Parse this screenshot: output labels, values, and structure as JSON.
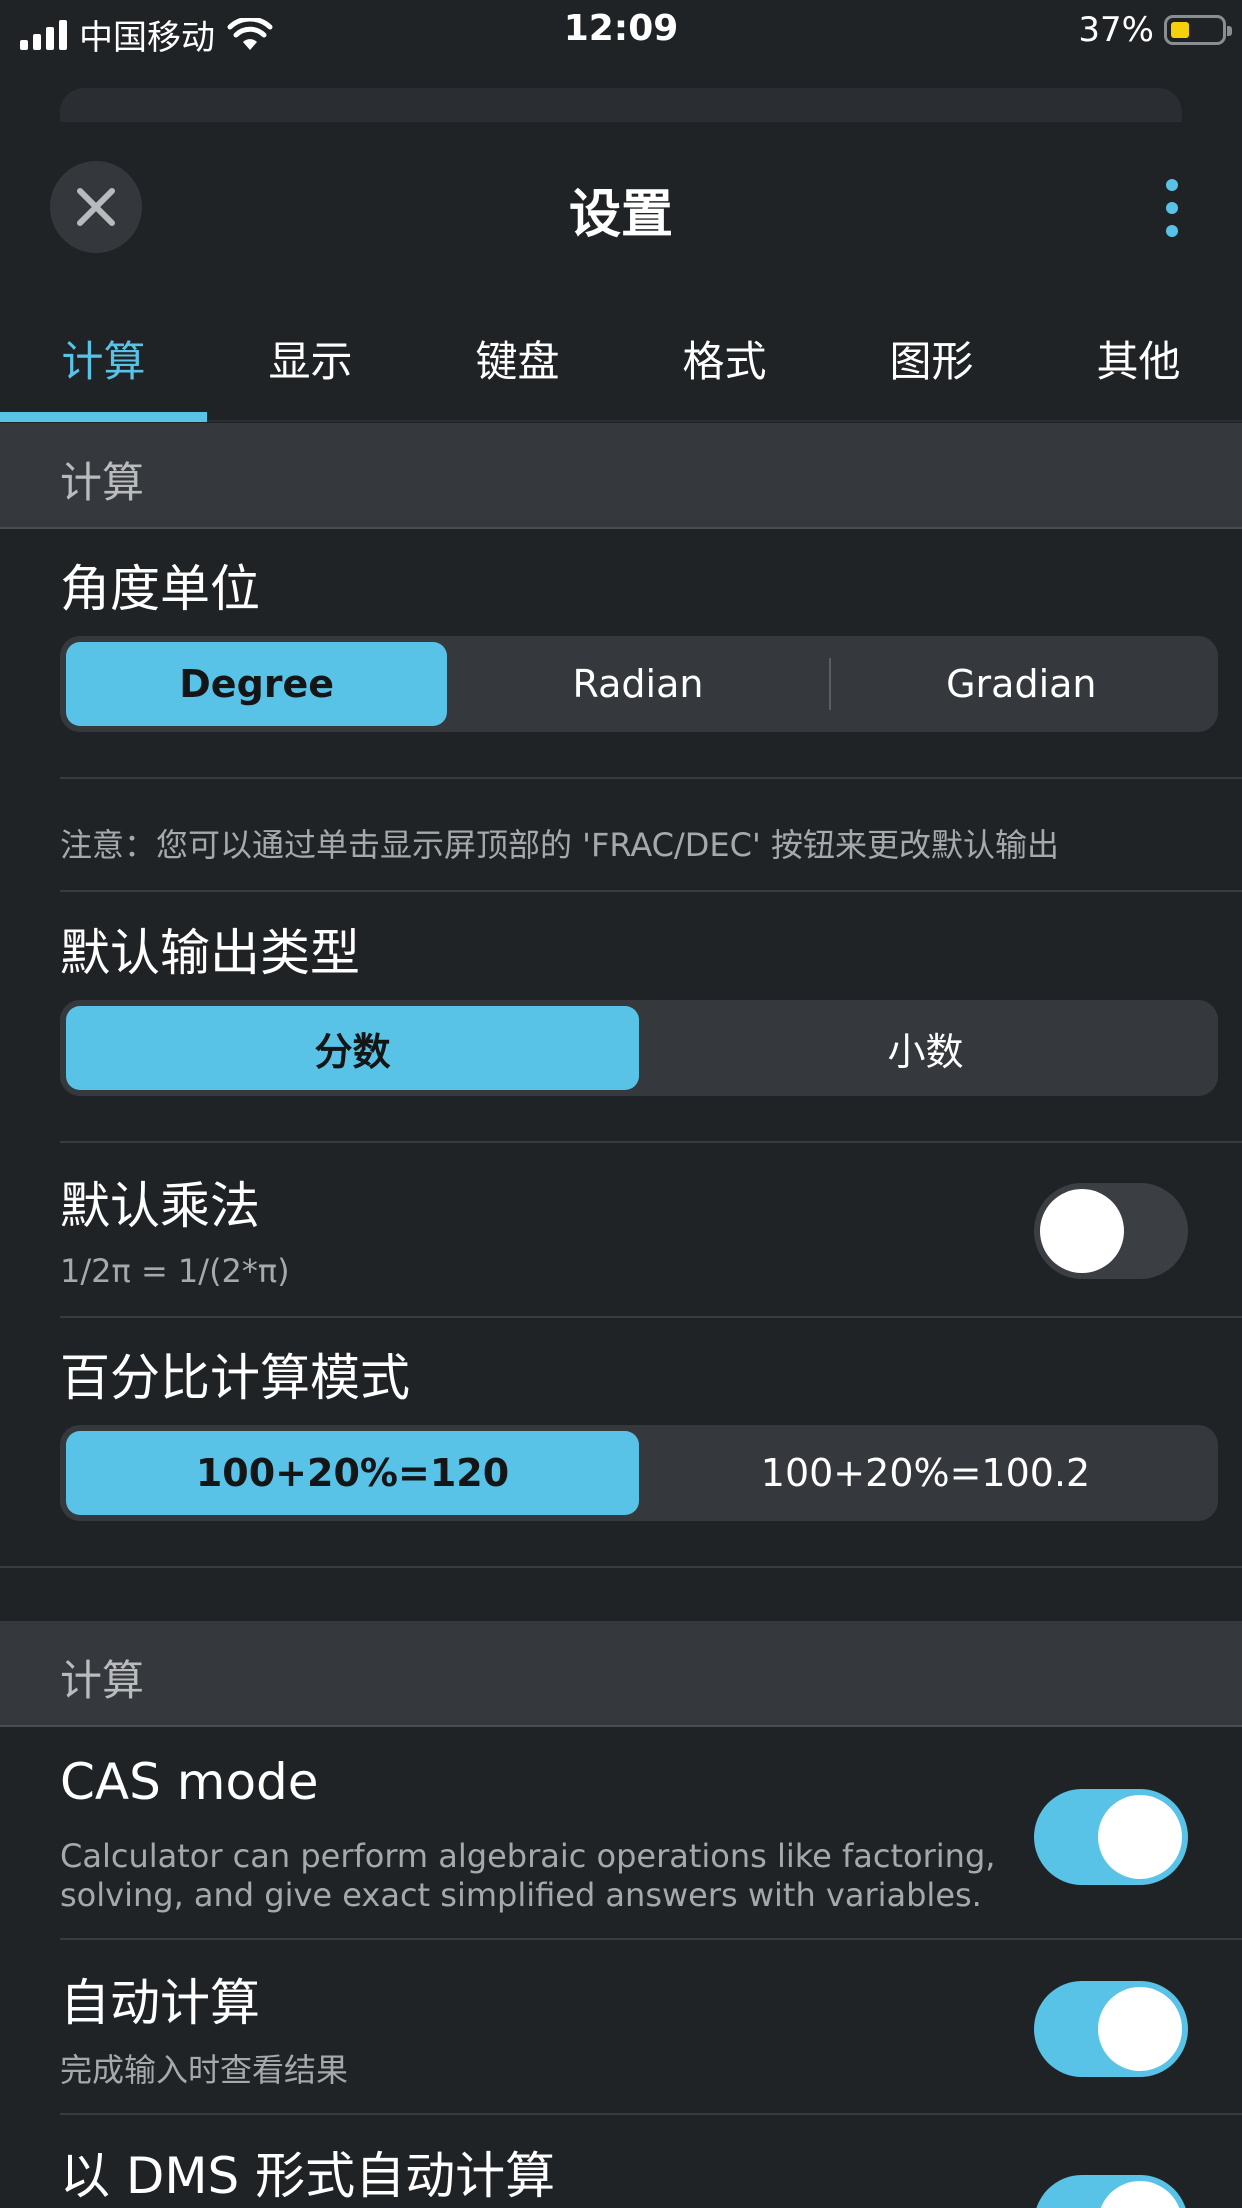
{
  "status_bar": {
    "carrier": "中国移动",
    "time": "12:09",
    "battery_percent": "37%",
    "battery_level": 0.37,
    "battery_color": "#f5d10c"
  },
  "header": {
    "title": "设置",
    "close_icon": "close-icon",
    "more_icon": "more-vertical-icon"
  },
  "tabs": [
    {
      "label": "计算",
      "active": true
    },
    {
      "label": "显示",
      "active": false
    },
    {
      "label": "键盘",
      "active": false
    },
    {
      "label": "格式",
      "active": false
    },
    {
      "label": "图形",
      "active": false
    },
    {
      "label": "其他",
      "active": false
    }
  ],
  "sections": {
    "first_header": "计算",
    "second_header": "计算"
  },
  "angle_unit": {
    "title": "角度单位",
    "options": [
      "Degree",
      "Radian",
      "Gradian"
    ],
    "selected": "Degree"
  },
  "note": "注意：您可以通过单击显示屏顶部的 'FRAC/DEC' 按钮来更改默认输出",
  "output_type": {
    "title": "默认输出类型",
    "options": [
      "分数",
      "小数"
    ],
    "selected": "分数"
  },
  "implicit_multiplication": {
    "title": "默认乘法",
    "description": "1/2π = 1/(2*π)",
    "enabled": false
  },
  "percent_mode": {
    "title": "百分比计算模式",
    "options": [
      "100+20%=120",
      "100+20%=100.2"
    ],
    "selected": "100+20%=120"
  },
  "cas_mode": {
    "title": "CAS mode",
    "description_line1": "Calculator can perform algebraic operations like factoring,",
    "description_line2": "solving, and give exact simplified answers with variables.",
    "enabled": true
  },
  "auto_calculate": {
    "title": "自动计算",
    "description": "完成输入时查看结果",
    "enabled": true
  },
  "dms_auto": {
    "title": "以 DMS 形式自动计算",
    "enabled": true
  },
  "colors": {
    "accent": "#59c3e7",
    "background": "#202326",
    "section_header": "#35393d"
  }
}
